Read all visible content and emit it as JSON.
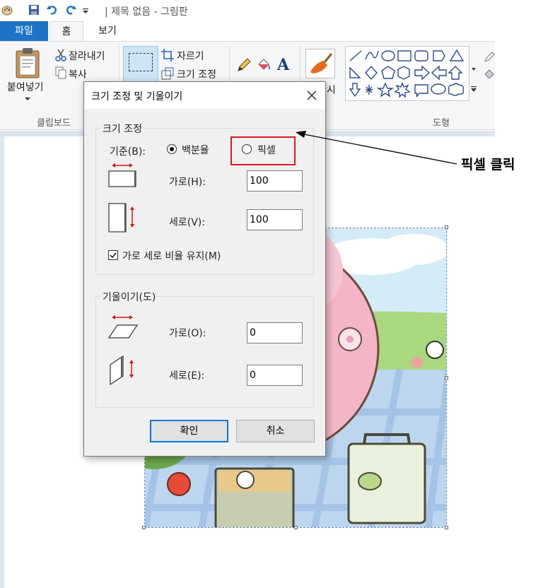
{
  "window": {
    "title": "| 제목 없음 - 그림판"
  },
  "tabs": {
    "file": "파일",
    "home": "홈",
    "view": "보기"
  },
  "ribbon": {
    "clipboard": {
      "paste": "붙여넣기",
      "cut": "잘라내기",
      "copy": "복사",
      "group_label": "클립보드"
    },
    "image": {
      "crop": "자르기",
      "resize": "크기 조정"
    },
    "brushes_fragment": "시",
    "shapes": {
      "group_label": "도형"
    }
  },
  "dialog": {
    "title": "크기 조정 및 기울이기",
    "resize": {
      "legend": "크기 조정",
      "basis_label": "기준(B):",
      "option_percent": "백분율",
      "option_pixel": "픽셀",
      "selected": "백분율",
      "horizontal_label": "가로(H):",
      "horizontal_value": "100",
      "vertical_label": "세로(V):",
      "vertical_value": "100",
      "maintain_ratio_label": "가로 세로 비율 유지(M)",
      "maintain_ratio_checked": true
    },
    "skew": {
      "legend": "기울이기(도)",
      "horizontal_label": "가로(O):",
      "horizontal_value": "0",
      "vertical_label": "세로(E):",
      "vertical_value": "0"
    },
    "ok_label": "확인",
    "cancel_label": "취소"
  },
  "annotation": {
    "text": "픽셀 클릭",
    "color": "#e0161c"
  },
  "colors": {
    "accent": "#1e73c8",
    "highlight": "#e0161c",
    "button_focus": "#0078d7"
  }
}
